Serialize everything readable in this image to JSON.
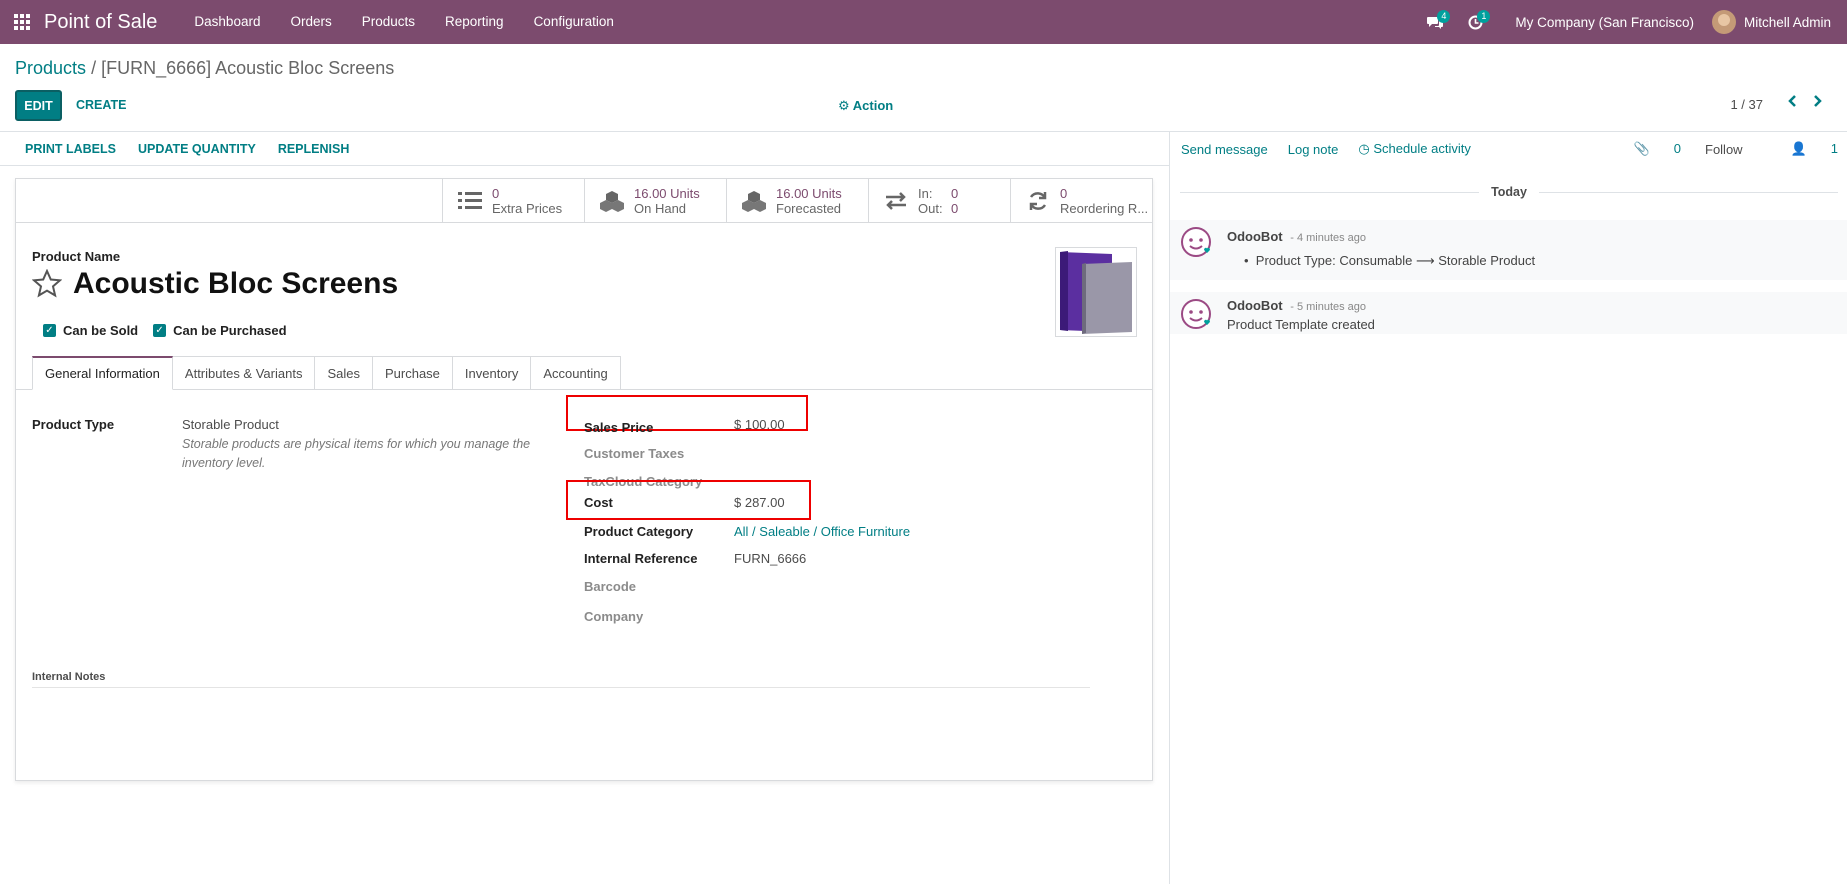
{
  "navbar": {
    "app_name": "Point of Sale",
    "menu": [
      "Dashboard",
      "Orders",
      "Products",
      "Reporting",
      "Configuration"
    ],
    "messages_badge": "4",
    "activities_badge": "1",
    "company": "My Company (San Francisco)",
    "user": "Mitchell Admin",
    "bg_color": "#7c4b6e"
  },
  "breadcrumb": {
    "parent": "Products",
    "separator": "/",
    "current": "[FURN_6666] Acoustic Bloc Screens"
  },
  "controls": {
    "edit": "EDIT",
    "create": "CREATE",
    "action": "Action",
    "pager": "1 / 37"
  },
  "status_buttons": [
    "PRINT LABELS",
    "UPDATE QUANTITY",
    "REPLENISH"
  ],
  "smart_buttons": {
    "extra_prices": {
      "value": "0",
      "label": "Extra Prices"
    },
    "on_hand": {
      "value": "16.00 Units",
      "label": "On Hand"
    },
    "forecasted": {
      "value": "16.00 Units",
      "label": "Forecasted"
    },
    "in_out": {
      "in_label": "In:",
      "in_value": "0",
      "out_label": "Out:",
      "out_value": "0"
    },
    "reordering": {
      "value": "0",
      "label": "Reordering R..."
    }
  },
  "product": {
    "name_label": "Product Name",
    "name": "Acoustic Bloc Screens",
    "can_be_sold": "Can be Sold",
    "can_be_purchased": "Can be Purchased"
  },
  "tabs": [
    "General Information",
    "Attributes & Variants",
    "Sales",
    "Purchase",
    "Inventory",
    "Accounting"
  ],
  "general": {
    "product_type_label": "Product Type",
    "product_type": "Storable Product",
    "help": "Storable products are physical items for which you manage the inventory level.",
    "sales_price_label": "Sales Price",
    "sales_price": "$ 100.00",
    "customer_taxes_label": "Customer Taxes",
    "taxcloud_label": "TaxCloud Category",
    "cost_label": "Cost",
    "cost": "$ 287.00",
    "category_label": "Product Category",
    "category": "All / Saleable / Office Furniture",
    "internal_ref_label": "Internal Reference",
    "internal_ref": "FURN_6666",
    "barcode_label": "Barcode",
    "company_label": "Company",
    "internal_notes_label": "Internal Notes"
  },
  "chatter": {
    "send_message": "Send message",
    "log_note": "Log note",
    "schedule_activity": "Schedule activity",
    "attachments": "0",
    "follow": "Follow",
    "followers": "1",
    "today": "Today",
    "messages": [
      {
        "author": "OdooBot",
        "time": "- 4 minutes ago",
        "body_prefix": "Product Type: Consumable",
        "body_suffix": "Storable Product"
      },
      {
        "author": "OdooBot",
        "time": "- 5 minutes ago",
        "body": "Product Template created"
      }
    ]
  }
}
